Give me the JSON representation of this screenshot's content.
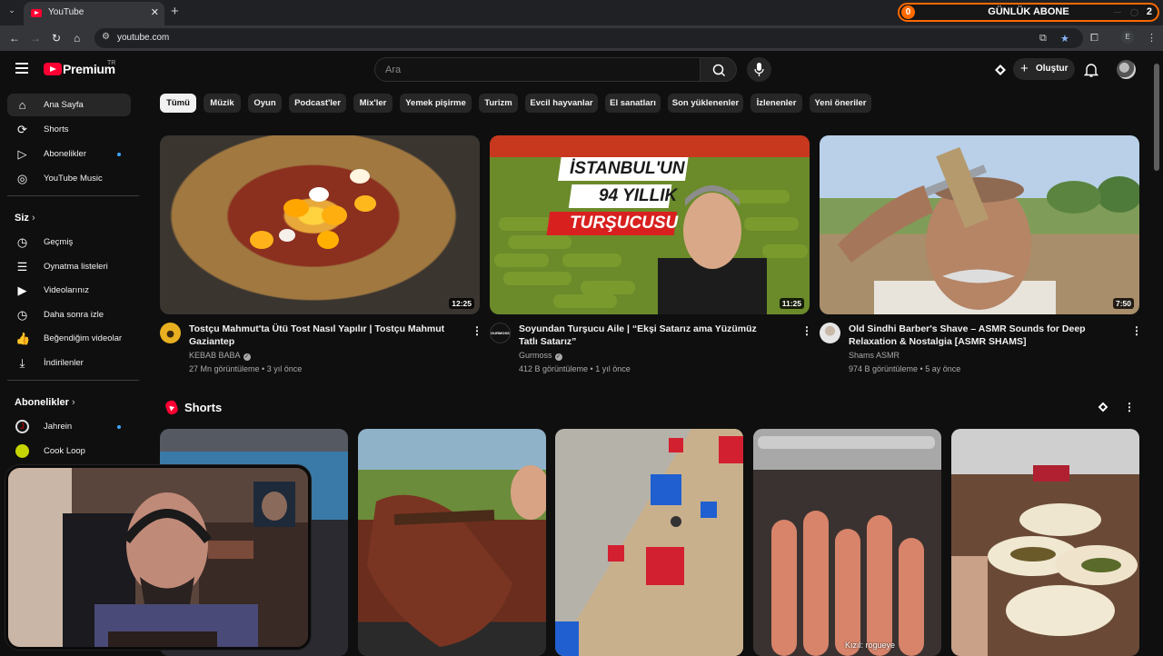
{
  "browser": {
    "tab_title": "YouTube",
    "url": "youtube.com",
    "profile_initial": "E"
  },
  "subscriber_widget": {
    "label": "GÜNLÜK ABONE",
    "left_count": "0",
    "right_count": "2"
  },
  "header": {
    "brand": "Premium",
    "country": "TR",
    "search_placeholder": "Ara",
    "create_label": "Oluştur"
  },
  "sidebar": {
    "main": [
      {
        "label": "Ana Sayfa",
        "icon": "home-icon",
        "active": true
      },
      {
        "label": "Shorts",
        "icon": "shorts-icon"
      },
      {
        "label": "Abonelikler",
        "icon": "subscriptions-icon",
        "dot": true
      },
      {
        "label": "YouTube Music",
        "icon": "music-icon"
      }
    ],
    "you_header": "Siz",
    "you": [
      {
        "label": "Geçmiş",
        "icon": "history-icon"
      },
      {
        "label": "Oynatma listeleri",
        "icon": "playlist-icon"
      },
      {
        "label": "Videolarınız",
        "icon": "your-videos-icon"
      },
      {
        "label": "Daha sonra izle",
        "icon": "watch-later-icon"
      },
      {
        "label": "Beğendiğim videolar",
        "icon": "liked-icon"
      },
      {
        "label": "İndirilenler",
        "icon": "download-icon"
      }
    ],
    "subs_header": "Abonelikler",
    "subs": [
      {
        "label": "Jahrein",
        "dot": true
      },
      {
        "label": "Cook Loop"
      }
    ]
  },
  "chips": [
    "Tümü",
    "Müzik",
    "Oyun",
    "Podcast'ler",
    "Mix'ler",
    "Yemek pişirme",
    "Turizm",
    "Evcil hayvanlar",
    "El sanatları",
    "Son yüklenenler",
    "İzlenenler",
    "Yeni öneriler"
  ],
  "videos": [
    {
      "title": "Tostçu Mahmut'ta Ütü Tost Nasıl Yapılır | Tostçu Mahmut Gaziantep",
      "channel": "KEBAB BABA",
      "meta": "27 Mn görüntüleme • 3 yıl önce",
      "duration": "12:25"
    },
    {
      "title": "Soyundan Turşucu Aile | “Ekşi Satarız ama Yüzümüz Tatlı Satarız”",
      "channel": "Gurmoss",
      "meta": "412 B görüntüleme • 1 yıl önce",
      "duration": "11:25",
      "overlay": [
        "İSTANBUL'UN",
        "94 YILLIK",
        "TURŞUCUSU"
      ],
      "channel_avatar_text": "GURMOSS"
    },
    {
      "title": "Old Sindhi Barber's Shave – ASMR Sounds for Deep Relaxation & Nostalgia [ASMR SHAMS]",
      "channel": "Shams ASMR",
      "meta": "974 B görüntüleme • 5 ay önce",
      "duration": "7:50"
    }
  ],
  "shorts": {
    "title": "Shorts",
    "caption": "Kızıl: rogueye"
  },
  "colors": {
    "accent": "#ff0033",
    "widget_border": "#ff6a00",
    "dot": "#3ea6ff"
  }
}
